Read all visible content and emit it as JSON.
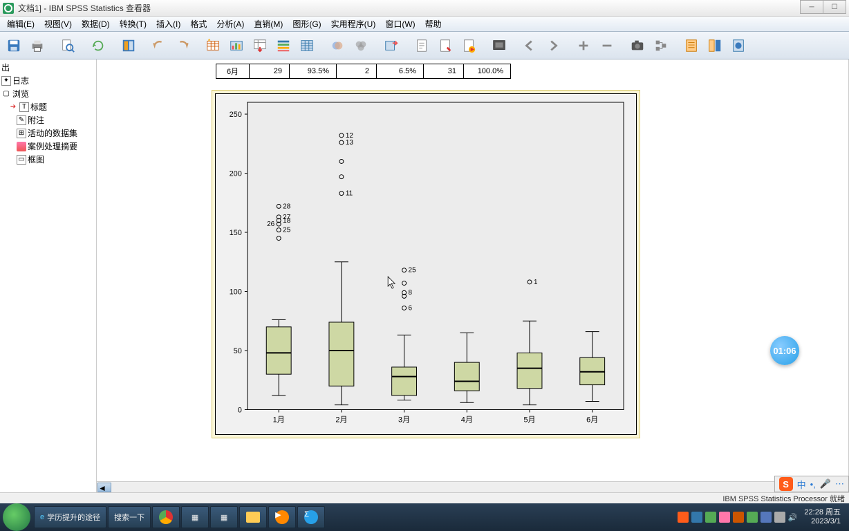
{
  "window": {
    "title": "文档1] - IBM SPSS Statistics 查看器"
  },
  "menu": {
    "edit": "编辑(E)",
    "view": "视图(V)",
    "data": "数据(D)",
    "transform": "转换(T)",
    "insert": "插入(I)",
    "format": "格式",
    "analyze": "分析(A)",
    "direct": "直销(M)",
    "graphs": "图形(G)",
    "util": "实用程序(U)",
    "window": "窗口(W)",
    "help": "帮助"
  },
  "outline": {
    "out": "出",
    "log": "日志",
    "browse": "浏览",
    "title": "标题",
    "notes": "附注",
    "dataset": "活动的数据集",
    "caseproc": "案例处理摘要",
    "boxplot": "框图"
  },
  "table": {
    "r_label": "6月",
    "c1": "29",
    "c2": "93.5%",
    "c3": "2",
    "c4": "6.5%",
    "c5": "31",
    "c6": "100.0%"
  },
  "status": {
    "text": "IBM SPSS Statistics Processor 就绪"
  },
  "taskbar": {
    "ie": "学历提升的途径",
    "search": "搜索一下",
    "time": "22:28 周五",
    "date": "2023/3/1"
  },
  "ime": {
    "cn": "中",
    "comma": "•,",
    "mic": "🎤"
  },
  "badge": {
    "text": "01:06"
  },
  "chart_data": {
    "type": "boxplot",
    "ylabel": "",
    "xlabel": "",
    "ylim": [
      0,
      260
    ],
    "yticks": [
      0,
      50,
      100,
      150,
      200,
      250
    ],
    "categories": [
      "1月",
      "2月",
      "3月",
      "4月",
      "5月",
      "6月"
    ],
    "boxes": [
      {
        "min": 12,
        "q1": 30,
        "median": 48,
        "q3": 70,
        "max": 76
      },
      {
        "min": 4,
        "q1": 20,
        "median": 50,
        "q3": 74,
        "max": 125
      },
      {
        "min": 8,
        "q1": 12,
        "median": 28,
        "q3": 36,
        "max": 63
      },
      {
        "min": 6,
        "q1": 16,
        "median": 24,
        "q3": 40,
        "max": 65
      },
      {
        "min": 4,
        "q1": 18,
        "median": 35,
        "q3": 48,
        "max": 75
      },
      {
        "min": 7,
        "q1": 21,
        "median": 32,
        "q3": 44,
        "max": 66
      }
    ],
    "outliers": [
      {
        "cat": 0,
        "y": 172,
        "label": "28"
      },
      {
        "cat": 0,
        "y": 163,
        "label": "27"
      },
      {
        "cat": 0,
        "y": 160,
        "label": "18"
      },
      {
        "cat": 0,
        "y": 157,
        "label": "26",
        "left": true
      },
      {
        "cat": 0,
        "y": 152,
        "label": "25"
      },
      {
        "cat": 0,
        "y": 145,
        "label": ""
      },
      {
        "cat": 1,
        "y": 232,
        "label": "12"
      },
      {
        "cat": 1,
        "y": 226,
        "label": "13"
      },
      {
        "cat": 1,
        "y": 210,
        "label": ""
      },
      {
        "cat": 1,
        "y": 197,
        "label": ""
      },
      {
        "cat": 1,
        "y": 183,
        "label": "11"
      },
      {
        "cat": 2,
        "y": 118,
        "label": "25"
      },
      {
        "cat": 2,
        "y": 107,
        "label": ""
      },
      {
        "cat": 2,
        "y": 99,
        "label": "8"
      },
      {
        "cat": 2,
        "y": 96,
        "label": ""
      },
      {
        "cat": 2,
        "y": 86,
        "label": "6"
      },
      {
        "cat": 4,
        "y": 108,
        "label": "1"
      }
    ]
  }
}
